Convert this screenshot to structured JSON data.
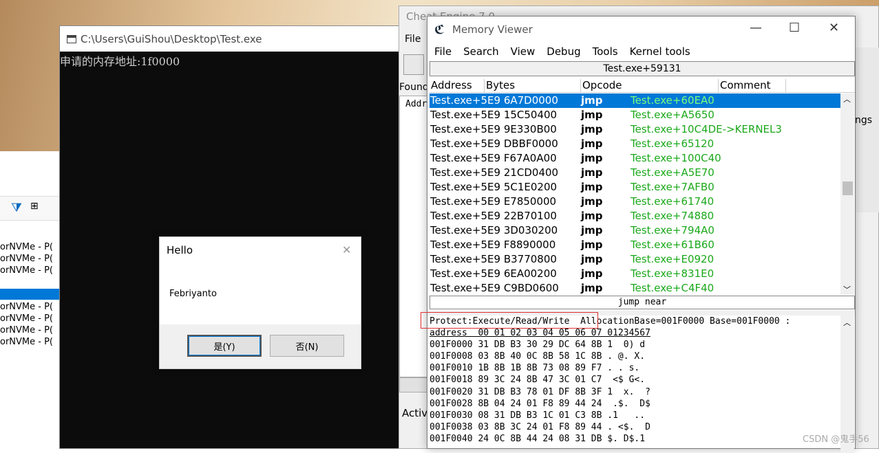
{
  "bg_rows": [
    "orNVMe - P(",
    "orNVMe - P(",
    "orNVMe - P(",
    "orNVMe - P(",
    "orNVMe - P(",
    "orNVMe - P(",
    "orNVMe - P("
  ],
  "console": {
    "title": "C:\\Users\\GuiShou\\Desktop\\Test.exe",
    "output": "申请的内存地址:1f0000"
  },
  "msgbox": {
    "title": "Hello",
    "message": "Febriyanto",
    "yes": "是(Y)",
    "no": "否(N)"
  },
  "ce": {
    "title": "Cheat Engine 7.0",
    "file": "File",
    "found": "Found",
    "addr": "Addr",
    "activ": "Activ",
    "right_text": "ngs"
  },
  "mv": {
    "title": "Memory Viewer",
    "menu": [
      "File",
      "Search",
      "View",
      "Debug",
      "Tools",
      "Kernel tools"
    ],
    "location": "Test.exe+59131",
    "headers": [
      "Address",
      "Bytes",
      "Opcode",
      "Comment"
    ],
    "rows": [
      {
        "addr": "Test.exe+5E9 6A7D0000",
        "op": "jmp",
        "cm": "Test.exe+60EA0"
      },
      {
        "addr": "Test.exe+5E9 15C50400",
        "op": "jmp",
        "cm": "Test.exe+A5650"
      },
      {
        "addr": "Test.exe+5E9 9E330B00",
        "op": "jmp",
        "cm": "Test.exe+10C4DE->KERNEL3"
      },
      {
        "addr": "Test.exe+5E9 DBBF0000",
        "op": "jmp",
        "cm": "Test.exe+65120"
      },
      {
        "addr": "Test.exe+5E9 F67A0A00",
        "op": "jmp",
        "cm": "Test.exe+100C40"
      },
      {
        "addr": "Test.exe+5E9 21CD0400",
        "op": "jmp",
        "cm": "Test.exe+A5E70"
      },
      {
        "addr": "Test.exe+5E9 5C1E0200",
        "op": "jmp",
        "cm": "Test.exe+7AFB0"
      },
      {
        "addr": "Test.exe+5E9 E7850000",
        "op": "jmp",
        "cm": "Test.exe+61740"
      },
      {
        "addr": "Test.exe+5E9 22B70100",
        "op": "jmp",
        "cm": "Test.exe+74880"
      },
      {
        "addr": "Test.exe+5E9 3D030200",
        "op": "jmp",
        "cm": "Test.exe+794A0"
      },
      {
        "addr": "Test.exe+5E9 F8890000",
        "op": "jmp",
        "cm": "Test.exe+61B60"
      },
      {
        "addr": "Test.exe+5E9 B3770800",
        "op": "jmp",
        "cm": "Test.exe+E0920"
      },
      {
        "addr": "Test.exe+5E9 6EA00200",
        "op": "jmp",
        "cm": "Test.exe+831E0"
      },
      {
        "addr": "Test.exe+5E9 C9BD0600",
        "op": "jmp",
        "cm": "Test.exe+C4F40"
      }
    ],
    "description": "jump near",
    "hex_status": "Protect:Execute/Read/Write  AllocationBase=001F0000 Base=001F0000 :",
    "hex_header": "address  00 01 02 03 04 05 06 07 01234567",
    "hex_lines": [
      "001F0000 31 DB B3 30 29 DC 64 8B 1  0) d",
      "001F0008 03 8B 40 0C 8B 58 1C 8B . @. X.",
      "001F0010 1B 8B 1B 8B 73 08 89 F7 . . s.",
      "001F0018 89 3C 24 8B 47 3C 01 C7  <$ G<.",
      "001F0020 31 DB B3 78 01 DF 8B 3F 1  x.  ?",
      "001F0028 8B 04 24 01 F8 89 44 24  .$.  D$",
      "001F0030 08 31 DB B3 1C 01 C3 8B .1   ..",
      "001F0038 03 8B 3C 24 01 F8 89 44 . <$.  D",
      "001F0040 24 0C 8B 44 24 08 31 DB $. D$.1"
    ]
  },
  "watermark": "CSDN @鬼手56"
}
